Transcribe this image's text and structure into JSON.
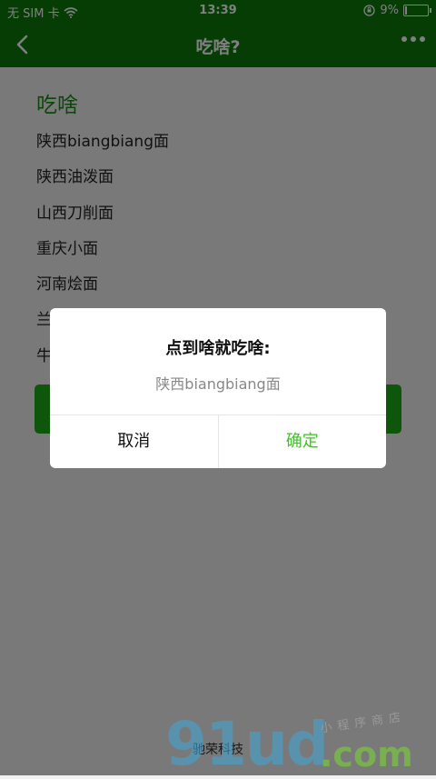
{
  "status_bar": {
    "carrier": "无 SIM 卡",
    "time": "13:39",
    "battery_text": "9%",
    "battery_level": 0.09
  },
  "nav": {
    "title": "吃啥?"
  },
  "page": {
    "section_title": "吃啥",
    "foods": [
      "陕西biangbiang面",
      "陕西油泼面",
      "山西刀削面",
      "重庆小面",
      "河南烩面",
      "兰",
      "牛"
    ],
    "footer": "驰荣科技"
  },
  "dialog": {
    "title": "点到啥就吃啥:",
    "content": "陕西biangbiang面",
    "cancel_label": "取消",
    "confirm_label": "确定"
  },
  "watermark": {
    "main": "91ud",
    "domain": ".com",
    "tagline": "小程序商店"
  },
  "colors": {
    "brand_green": "#0a7a0a",
    "button_green": "#1aad19",
    "confirm_green": "#3cc51f"
  }
}
